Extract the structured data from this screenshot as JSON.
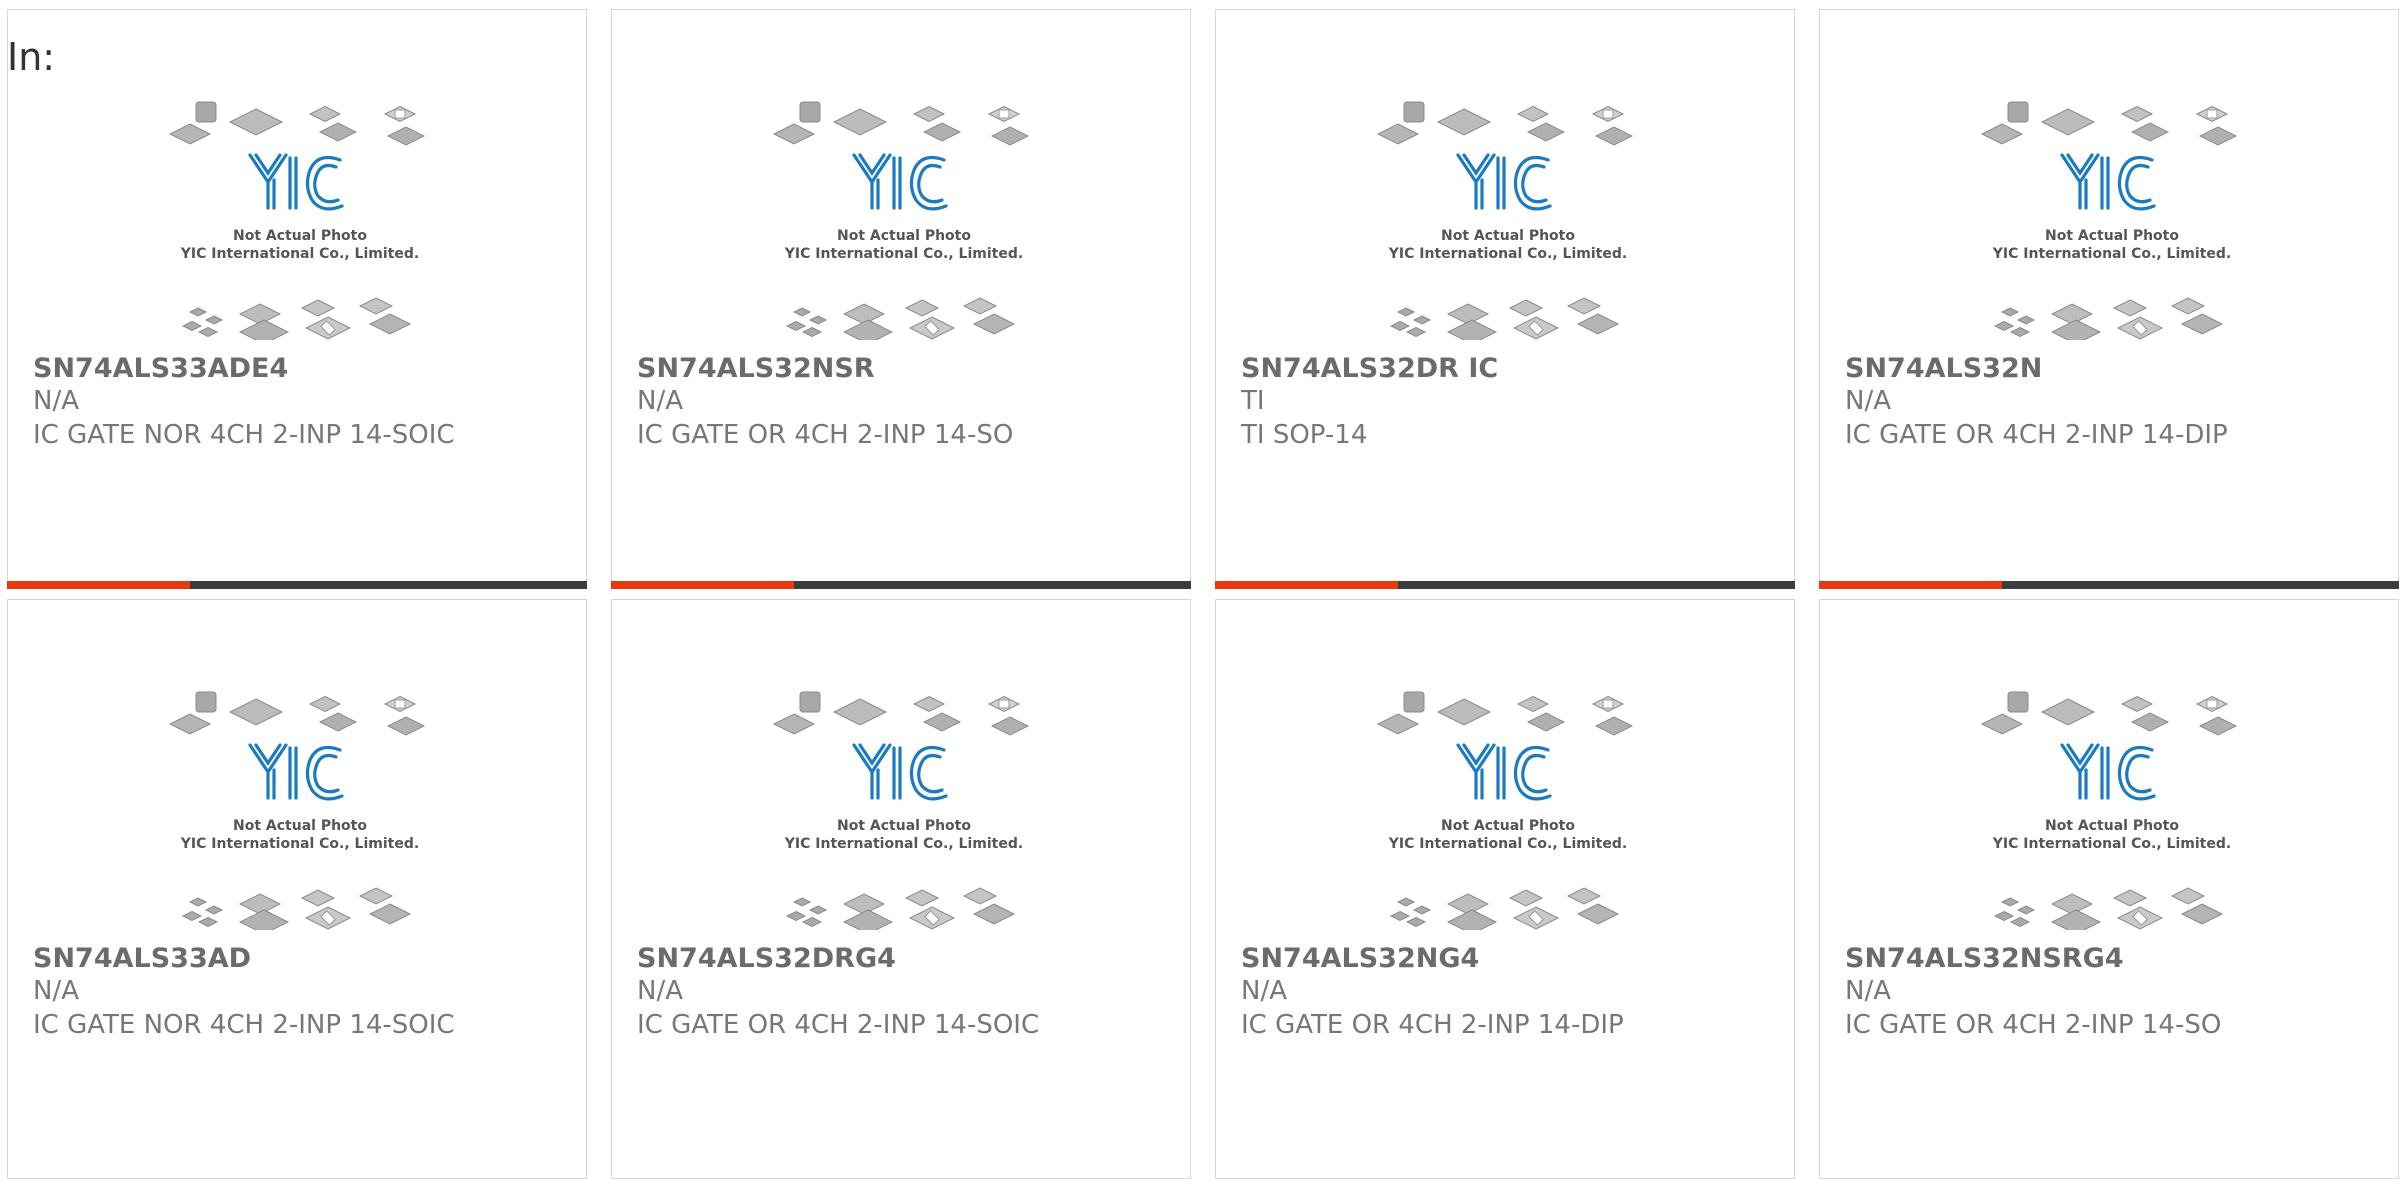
{
  "page": {
    "label": "In:"
  },
  "placeholder": {
    "caption_line1": "Not Actual Photo",
    "caption_line2": "YIC International Co., Limited.",
    "logo_text": "YIC"
  },
  "colors": {
    "accent": "#e8380d",
    "bar": "#3d3d3d",
    "logo": "#1a7bc2"
  },
  "products": [
    {
      "part": "SN74ALS33ADE4",
      "maker": "N/A",
      "desc": "IC GATE NOR 4CH 2-INP 14-SOIC",
      "highlighted": true
    },
    {
      "part": "SN74ALS32NSR",
      "maker": "N/A",
      "desc": "IC GATE OR 4CH 2-INP 14-SO",
      "highlighted": true
    },
    {
      "part": "SN74ALS32DR IC",
      "maker": "TI",
      "desc": "TI SOP-14",
      "highlighted": true
    },
    {
      "part": "SN74ALS32N",
      "maker": "N/A",
      "desc": "IC GATE OR 4CH 2-INP 14-DIP",
      "highlighted": true
    },
    {
      "part": "SN74ALS33AD",
      "maker": "N/A",
      "desc": "IC GATE NOR 4CH 2-INP 14-SOIC",
      "highlighted": false
    },
    {
      "part": "SN74ALS32DRG4",
      "maker": "N/A",
      "desc": "IC GATE OR 4CH 2-INP 14-SOIC",
      "highlighted": false
    },
    {
      "part": "SN74ALS32NG4",
      "maker": "N/A",
      "desc": "IC GATE OR 4CH 2-INP 14-DIP",
      "highlighted": false
    },
    {
      "part": "SN74ALS32NSRG4",
      "maker": "N/A",
      "desc": "IC GATE OR 4CH 2-INP 14-SO",
      "highlighted": false
    }
  ]
}
